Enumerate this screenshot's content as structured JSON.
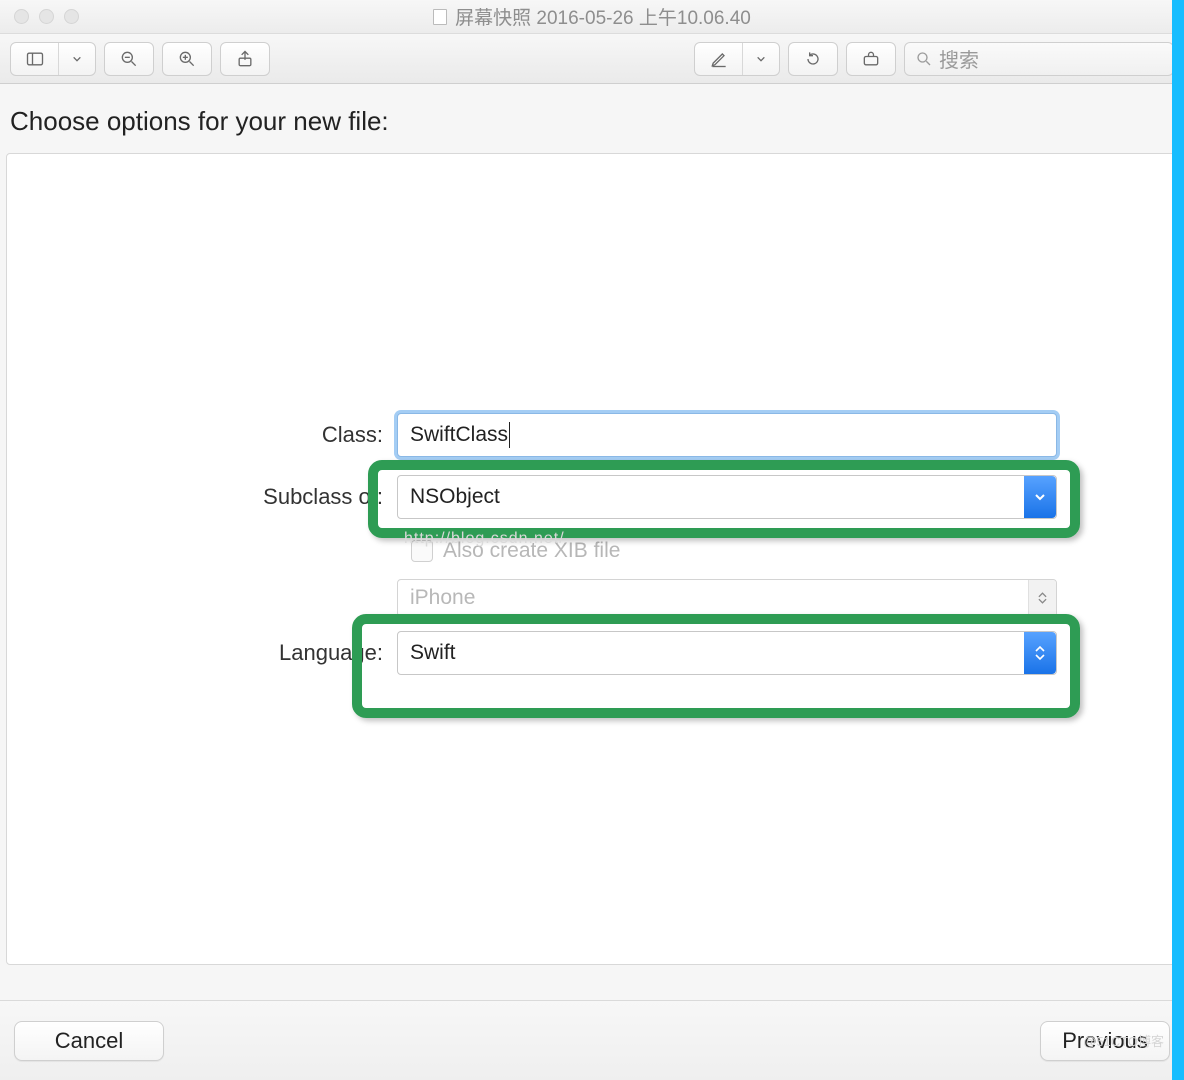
{
  "window": {
    "title": "屏幕快照 2016-05-26 上午10.06.40"
  },
  "toolbar": {
    "search_placeholder": "搜索"
  },
  "heading": "Choose options for your new file:",
  "form": {
    "class_label": "Class:",
    "class_value": "SwiftClass",
    "subclass_label": "Subclass of:",
    "subclass_value": "NSObject",
    "xib_label": "Also create XIB file",
    "xib_checked": false,
    "device_value": "iPhone",
    "language_label": "Language:",
    "language_value": "Swift"
  },
  "footer": {
    "cancel": "Cancel",
    "previous": "Previous"
  },
  "watermark": "http://blog.csdn.net/",
  "corner_watermark": "@51CTO博客",
  "colors": {
    "highlight_green": "#2e9c54",
    "accent_blue": "#1a73e8",
    "right_bar": "#17bdff"
  }
}
